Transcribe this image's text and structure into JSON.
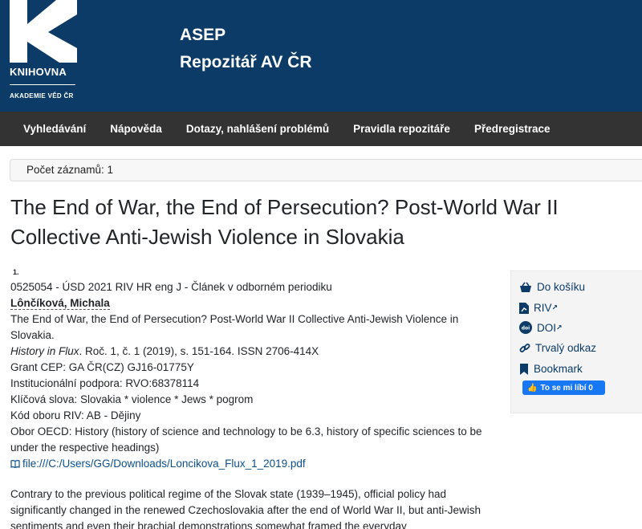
{
  "header": {
    "logo_name": "KNIHOVNA",
    "logo_sub": "AKADEMIE VĚD ČR",
    "title": "ASEP",
    "subtitle": "Repozitář AV ČR",
    "background": "#0b3b66"
  },
  "nav": {
    "items": [
      "Vyhledávání",
      "Nápověda",
      "Dotazy, nahlášení problémů",
      "Pravidla repozitáře",
      "Předregistrace"
    ],
    "background": "#333333"
  },
  "results": {
    "count_label": "Počet záznamů: 1"
  },
  "record": {
    "title": "The End of War, the End of Persecution? Post-World War II Collective Anti-Jewish Violence in Slovakia",
    "number": "1.",
    "id_line": "0525054 - ÚSD 2021 RIV HR eng J - Článek v odborném periodiku",
    "author": "Lônčíková, Michala",
    "article_title": "The End of War, the End of Persecution? Post-World War II Collective Anti-Jewish Violence in Slovakia.",
    "journal": "History in Flux",
    "journal_details": ". Roč. 1, č. 1 (2019), s. 151-164. ISSN 2706-414X",
    "grant": "Grant CEP: GA ČR(CZ) GJ16-01775Y",
    "support": "Institucionální podpora: RVO:68378114",
    "keywords": "Klíčová slova: Slovakia * violence * Jews * pogrom",
    "riv_code": "Kód oboru RIV: AB - Dějiny",
    "oecd": "Obor OECD: History (history of science and technology to be 6.3, history of specific sciences to be under the respective headings)",
    "file_link": "file:///C:/Users/GG/Downloads/Loncikova_Flux_1_2019.pdf",
    "abstract": "Contrary to the previous political regime of the Slovak state (1939–1945), official policy had significantly changed in the renewed Czechoslovakia after the end of World War II, but anti-Jewish sentiments and even their brachial demonstrations somewhat framed the everyday"
  },
  "sidebar": {
    "cart": "Do košíku",
    "riv": "RIV",
    "doi": "DOI",
    "permalink": "Trvalý odkaz",
    "bookmark": "Bookmark",
    "fb_like": "To se mi líbí 0",
    "link_color": "#0b3b66",
    "fb_color": "#1877f2"
  }
}
